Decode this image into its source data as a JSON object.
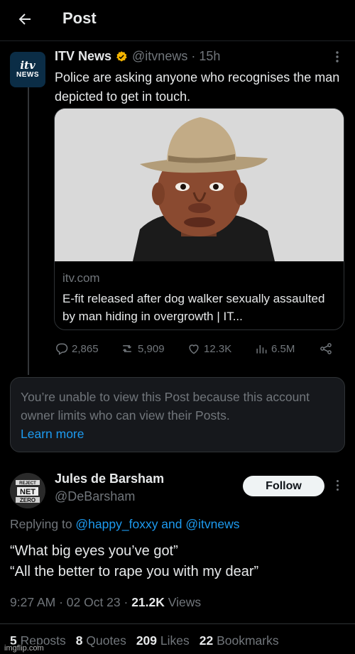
{
  "header": {
    "title": "Post",
    "back_icon": "arrow-left-icon"
  },
  "tweet": {
    "avatar": {
      "line1": "itv",
      "line2": "NEWS"
    },
    "name": "ITV News",
    "handle": "@itvnews · 15h",
    "text": "Police are asking anyone who recognises the man depicted to get in touch.",
    "card": {
      "domain": "itv.com",
      "title": "E-fit released after dog walker sexually assaulted by man hiding in overgrowth | IT..."
    },
    "actions": {
      "replies": "2,865",
      "reposts": "5,909",
      "likes": "12.3K",
      "views": "6.5M"
    }
  },
  "notice": {
    "text": "You’re unable to view this Post because this account owner limits who can view their Posts.",
    "link": "Learn more"
  },
  "reply": {
    "avatar_text": [
      "REJECT",
      "NET",
      "ZERO"
    ],
    "name": "Jules de Barsham",
    "handle": "@DeBarsham",
    "follow_label": "Follow",
    "replying_prefix": "Replying to ",
    "replying_mentions": "@happy_foxxy and @itvnews",
    "body_line1": "“What big eyes you’ve got”",
    "body_line2": "“All the better to rape you with my dear”",
    "time": "9:27 AM · 02 Oct 23 · ",
    "views_count": "21.2K",
    "views_label": " Views",
    "stats": {
      "reposts_count": "5",
      "reposts_label": " Reposts",
      "quotes_count": "8",
      "quotes_label": " Quotes",
      "likes_count": "209",
      "likes_label": " Likes",
      "bookmarks_count": "22",
      "bookmarks_label": " Bookmarks"
    }
  },
  "watermark": "imgflip.com",
  "colors": {
    "background": "#000000",
    "link": "#1d9bf0",
    "secondary": "#71767b",
    "verified": "#f4b400"
  }
}
